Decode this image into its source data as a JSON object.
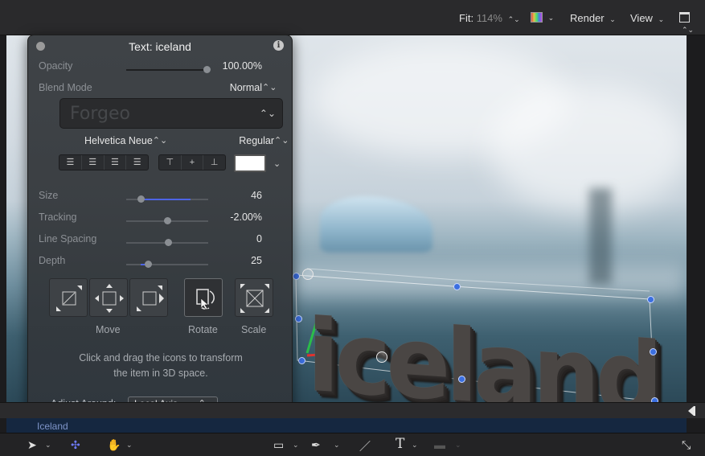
{
  "topbar": {
    "fit_label": "Fit:",
    "fit_value": "114%",
    "render_label": "Render",
    "view_label": "View"
  },
  "inspector": {
    "title": "Text: iceland",
    "info_glyph": "i",
    "opacity_label": "Opacity",
    "opacity_value": "100.00%",
    "opacity_level": 1.0,
    "blend_label": "Blend Mode",
    "blend_value": "Normal",
    "font_preview": "Forgeo",
    "font_family": "Helvetica Neue",
    "font_style": "Regular",
    "text_color": "#ffffff",
    "size_label": "Size",
    "size_value": "46",
    "tracking_label": "Tracking",
    "tracking_value": "-2.00%",
    "line_spacing_label": "Line Spacing",
    "line_spacing_value": "0",
    "depth_label": "Depth",
    "depth_value": "25",
    "move_label": "Move",
    "rotate_label": "Rotate",
    "scale_label": "Scale",
    "help_line1": "Click and drag the icons to transform",
    "help_line2": "the item in 3D space.",
    "adjust_label": "Adjust Around:",
    "adjust_value": "Local Axis"
  },
  "canvas": {
    "text_object": "iceland"
  },
  "timeline": {
    "track_label": "Iceland"
  },
  "colors": {
    "accent": "#4d64e6",
    "handle": "#3b6fe0"
  },
  "icons": [
    "stepper-icon",
    "color-picker-icon",
    "chevron-down-icon",
    "info-icon",
    "arrow-tool-icon",
    "transform-orbit-icon",
    "hand-icon",
    "rectangle-tool-icon",
    "pen-tool-icon",
    "brush-icon",
    "text-tool-icon",
    "mask-icon",
    "expand-icon"
  ]
}
